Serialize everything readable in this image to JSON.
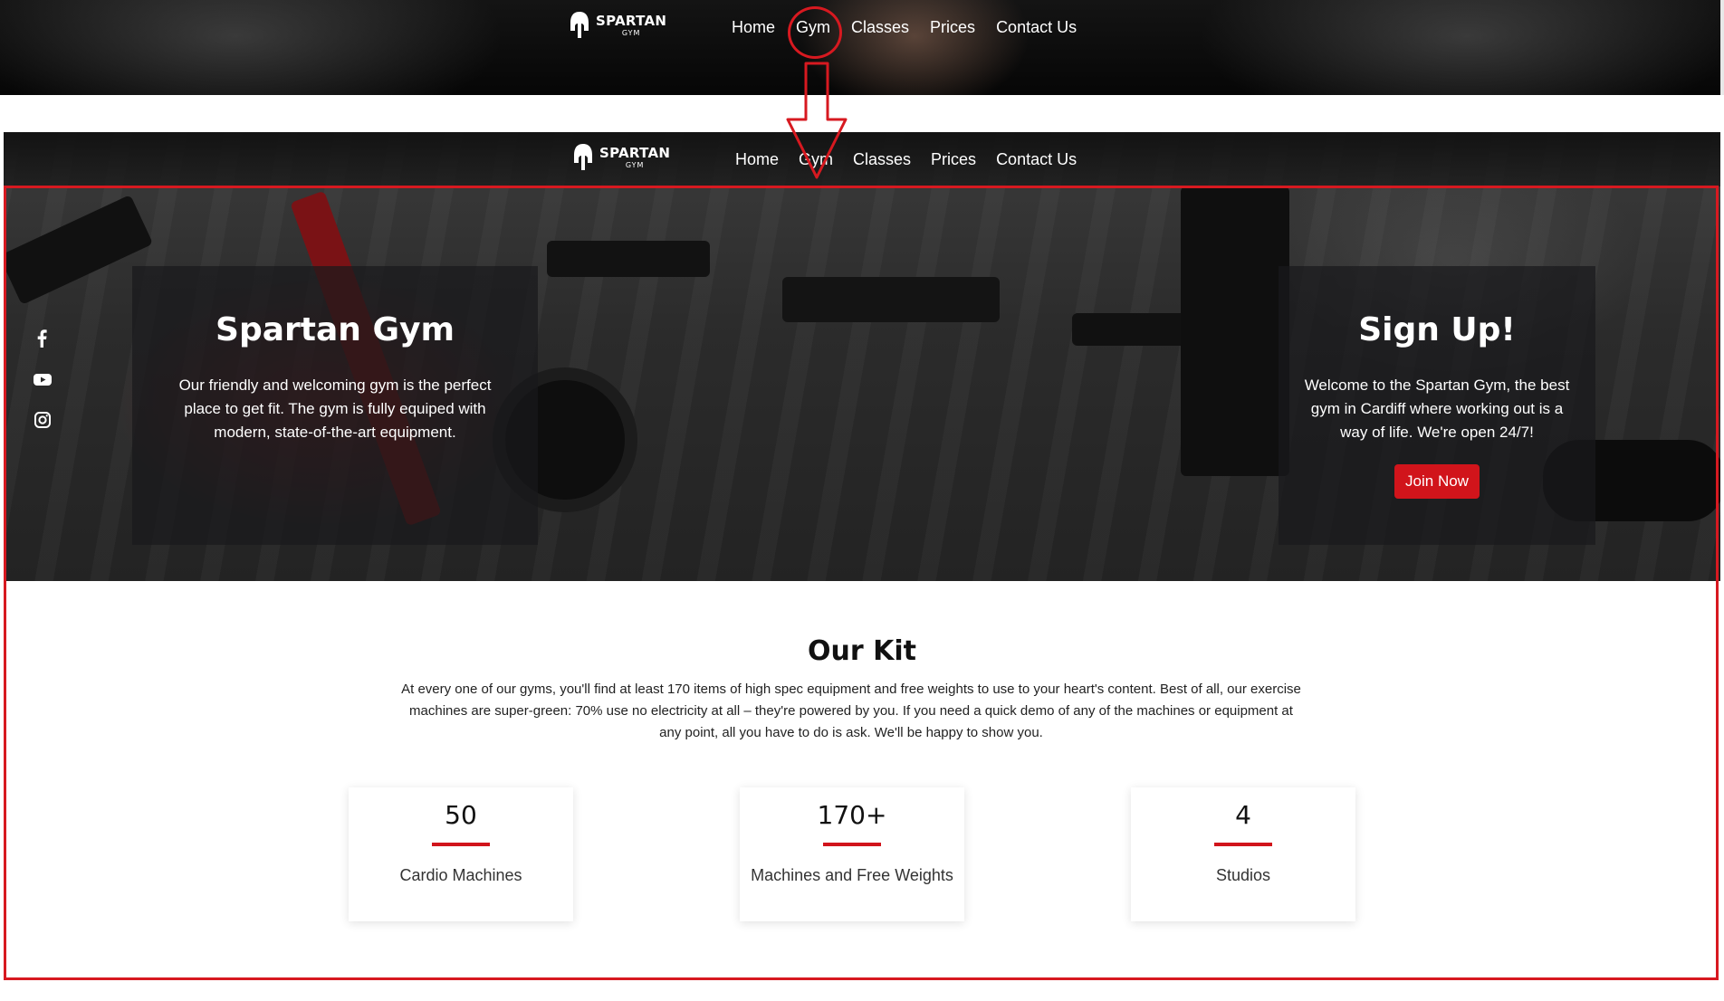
{
  "brand": {
    "name": "SPARTAN",
    "sub": "GYM"
  },
  "nav": [
    "Home",
    "Gym",
    "Classes",
    "Prices",
    "Contact Us"
  ],
  "annotation": {
    "color": "#d71920",
    "highlighted_nav": "Gym"
  },
  "hero": {
    "left": {
      "title": "Spartan Gym",
      "text": "Our friendly and welcoming gym is the perfect place to get fit. The gym is fully equiped with modern, state-of-the-art equipment."
    },
    "right": {
      "title": "Sign Up!",
      "text": "Welcome to the Spartan Gym, the best gym in Cardiff where working out is a way of life. We're open 24/7!",
      "button": "Join Now"
    },
    "social_icons": [
      "facebook-icon",
      "youtube-icon",
      "instagram-icon"
    ]
  },
  "kit": {
    "title": "Our Kit",
    "text": "At every one of our gyms, you'll find at least 170 items of high spec equipment and free weights to use to your heart's content. Best of all, our exercise machines are super-green: 70% use no electricity at all – they're powered by you. If you need a quick demo of any of the machines or equipment at any point, all you have to do is ask. We'll be happy to show you.",
    "stats": [
      {
        "value": "50",
        "label": "Cardio Machines"
      },
      {
        "value": "170+",
        "label": "Machines and Free Weights"
      },
      {
        "value": "4",
        "label": "Studios"
      }
    ]
  },
  "colors": {
    "accent": "#d1141b",
    "dark": "#1a1a1a"
  }
}
